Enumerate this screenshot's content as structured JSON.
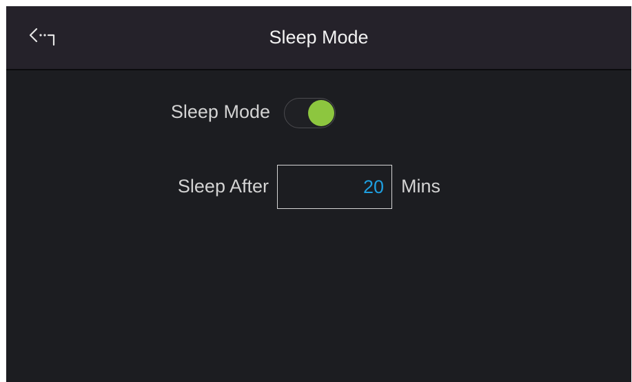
{
  "header": {
    "title": "Sleep Mode",
    "back_icon": "back-arrow-icon"
  },
  "settings": {
    "sleep_mode": {
      "label": "Sleep Mode",
      "enabled": true,
      "on_color": "#8dc63f"
    },
    "sleep_after": {
      "label": "Sleep After",
      "value": "20",
      "unit": "Mins",
      "value_color": "#1e9fe0"
    }
  }
}
